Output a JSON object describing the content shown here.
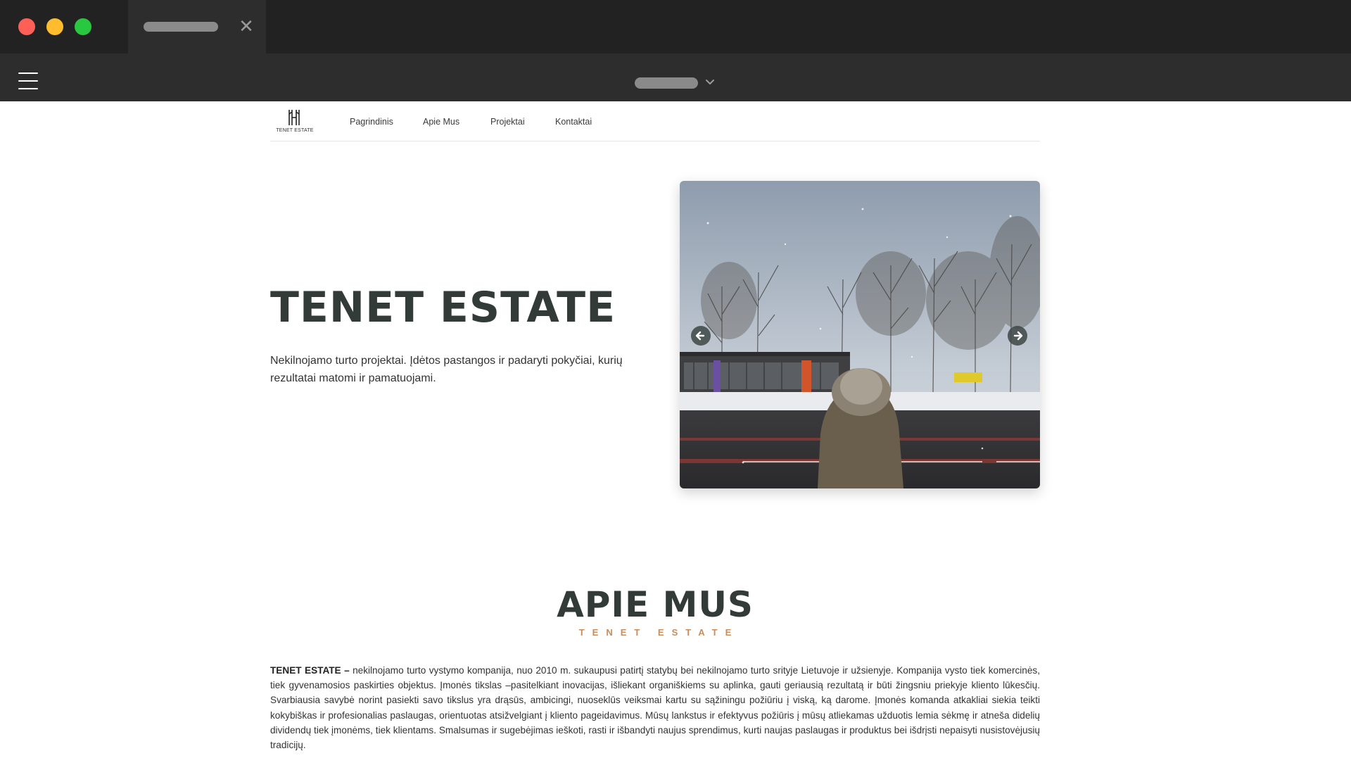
{
  "browser": {
    "tab_close_glyph": "✕"
  },
  "site": {
    "logo_text": "TENET ESTATE",
    "nav": [
      "Pagrindinis",
      "Apie Mus",
      "Projektai",
      "Kontaktai"
    ]
  },
  "hero": {
    "title": "TENET ESTATE",
    "subtitle": "Nekilnojamo turto projektai. Įdėtos pastangos ir padaryti pokyčiai, kurių rezultatai matomi ir pamatuojami.",
    "slider": {
      "image": "winter-street-building-with-person-photo",
      "prev_icon": "arrow-left-icon",
      "next_icon": "arrow-right-icon"
    }
  },
  "about": {
    "title": "APIE MUS",
    "tag": "TENET ESTATE",
    "lead": "TENET ESTATE –",
    "body": " nekilnojamo turto vystymo kompanija, nuo 2010 m. sukaupusi patirtį statybų bei nekilnojamo turto srityje Lietuvoje ir užsienyje. Kompanija vysto tiek komercinės, tiek gyvenamosios paskirties objektus. Įmonės tikslas –pasitelkiant inovacijas, išliekant organiškiems su aplinka, gauti geriausią rezultatą ir būti žingsniu priekyje kliento lūkesčių. Svarbiausia savybė norint pasiekti savo tikslus yra drąsūs, ambicingi, nuoseklūs veiksmai kartu su sąžiningu požiūriu į viską, ką darome. Įmonės komanda atkakliai siekia teikti kokybiškas ir profesionalias paslaugas, orientuotas atsižvelgiant į kliento pageidavimus. Mūsų lankstus ir efektyvus požiūris į mūsų atliekamas užduotis lemia sėkmę ir atneša didelių dividendų tiek įmonėms, tiek klientams. Smalsumas ir sugebėjimas ieškoti, rasti ir išbandyti naujus sprendimus, kurti naujas paslaugas ir produktus bei išdrįsti nepaisyti nusistovėjusių tradicijų."
  },
  "colors": {
    "chrome_dark": "#222222",
    "chrome_bar": "#2d2d2d",
    "heading": "#333b39",
    "accent": "#c98c5a"
  }
}
